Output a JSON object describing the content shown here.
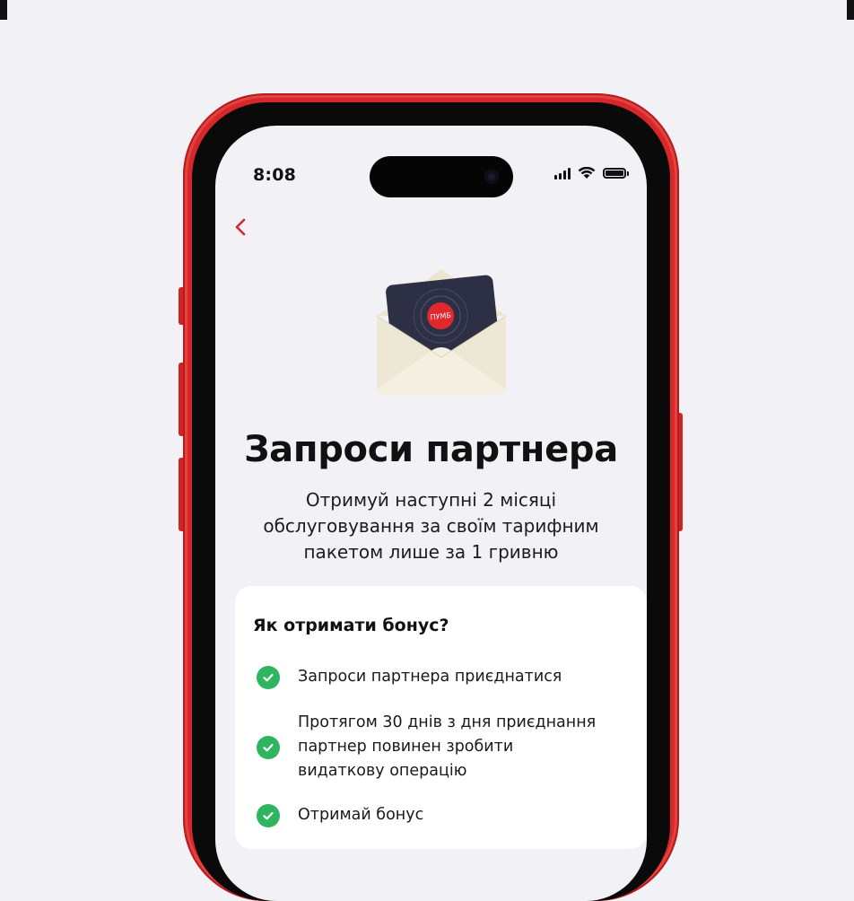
{
  "status_bar": {
    "time": "8:08"
  },
  "illustration": {
    "logo_text": "ПУМБ"
  },
  "header": {
    "title": "Запроси партнера",
    "subtitle_lines": [
      "Отримуй наступні 2 місяці",
      "обслуговування за своїм тарифним",
      "пакетом лише за 1 гривню"
    ]
  },
  "bonus_card": {
    "title": "Як отримати бонус?",
    "steps": [
      {
        "lines": [
          "Запроси партнера приєднатися"
        ]
      },
      {
        "lines": [
          "Протягом 30 днів з дня приєднання",
          "партнер повинен зробити",
          "видаткову операцію"
        ]
      },
      {
        "lines": [
          "Отримай бонус"
        ]
      }
    ]
  },
  "colors": {
    "accent": "#d6282a",
    "check": "#2fb560",
    "background": "#f2f1f6"
  }
}
